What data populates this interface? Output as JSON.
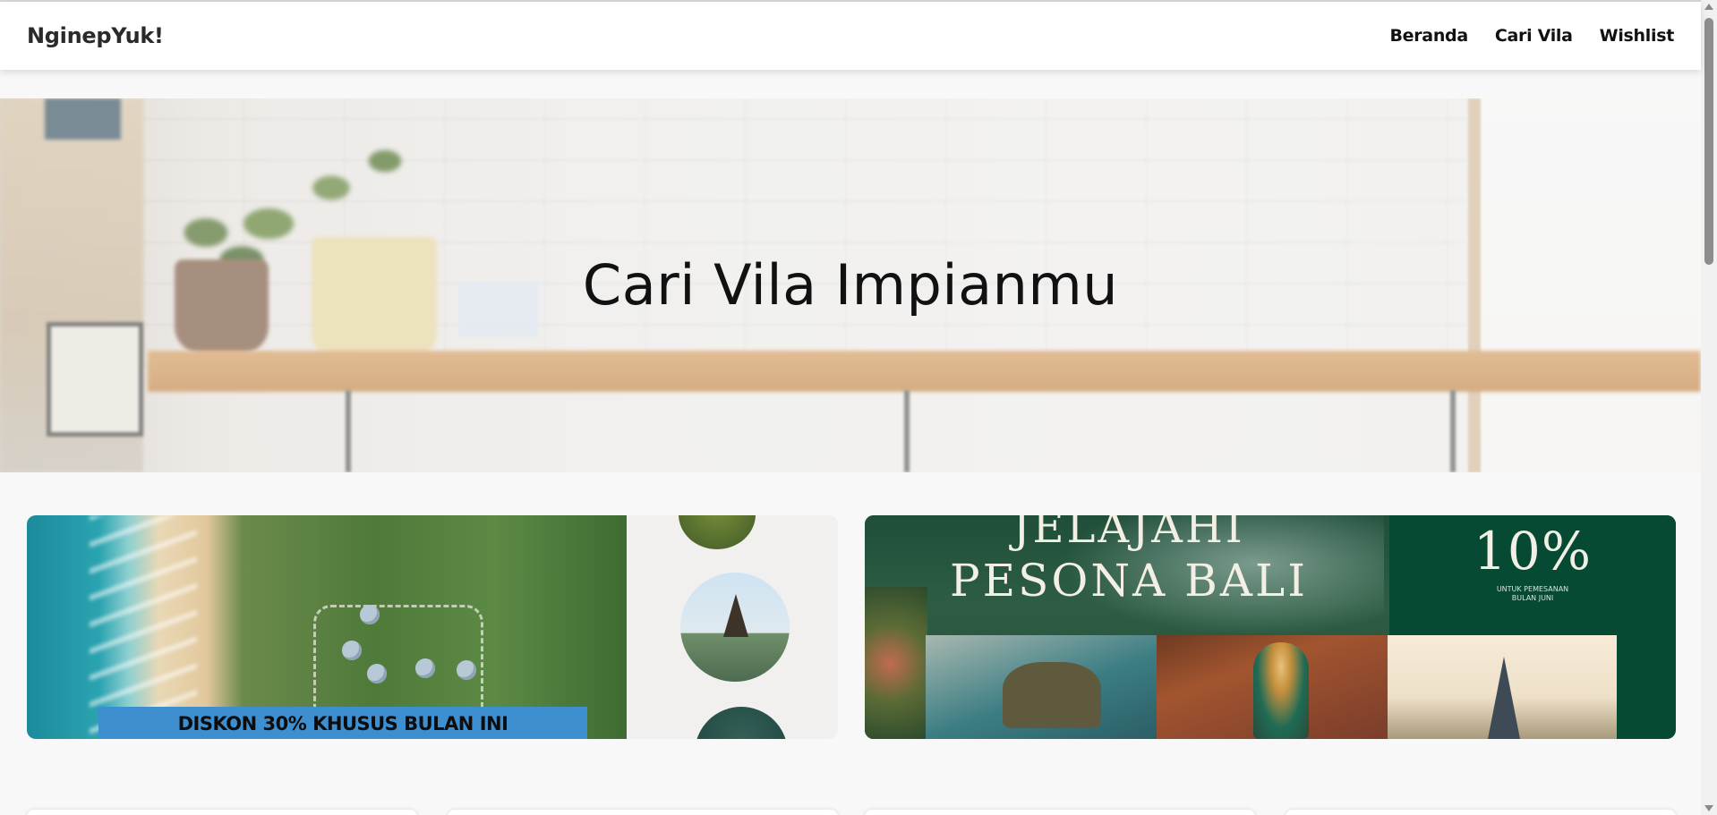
{
  "navbar": {
    "brand": "NginepYuk!",
    "links": [
      "Beranda",
      "Cari Vila",
      "Wishlist"
    ]
  },
  "hero": {
    "title": "Cari Vila Impianmu"
  },
  "promos": [
    {
      "label": "DISKON 30% KHUSUS BULAN INI"
    },
    {
      "title_line1": "JELAJAHI",
      "title_line2": "PESONA BALI",
      "percent": "10%",
      "small_line1": "UNTUK PEMESANAN",
      "small_line2": "BULAN JUNI"
    }
  ],
  "colors": {
    "nav_bg": "#ffffff",
    "page_bg": "#f8f8f8",
    "promo_strip": "#3d8fcf",
    "promo_green": "#064a33"
  }
}
